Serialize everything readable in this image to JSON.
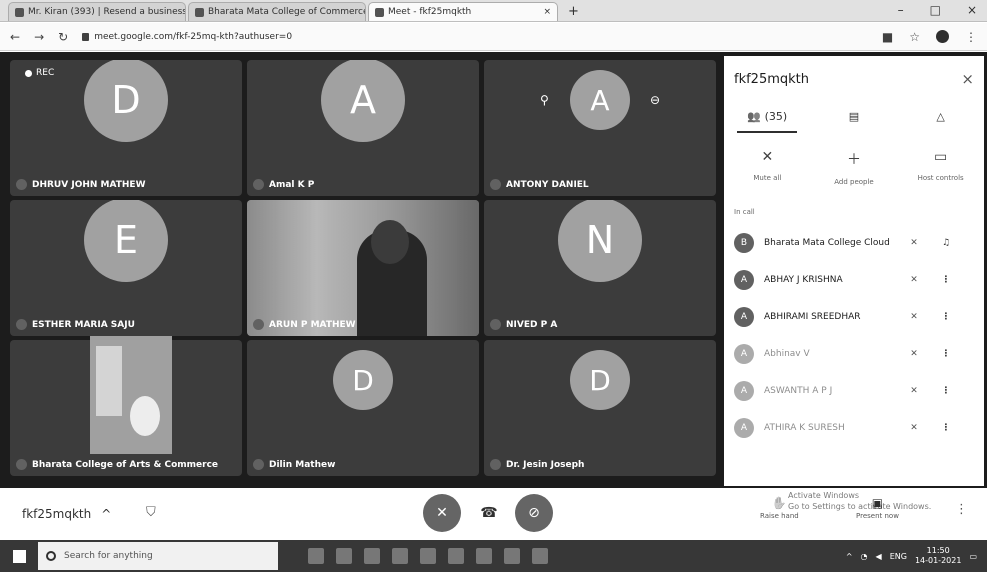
{
  "browser": {
    "tabs": [
      {
        "title": "Mr. Kiran (393) | Resend a business..."
      },
      {
        "title": "Bharata Mata College of Commerce & Mat..."
      },
      {
        "title": "Meet - fkf25mqkth"
      }
    ],
    "new_tab_label": "+",
    "url": "meet.google.com/fkf-25mq-kth?authuser=0",
    "window_controls": {
      "minimize": "–",
      "maximize": "□",
      "close": "×"
    }
  },
  "meeting": {
    "rec_label": "REC",
    "tiles": [
      {
        "initial": "D",
        "name": "DHRUV JOHN MATHEW"
      },
      {
        "initial": "A",
        "name": "Amal K P"
      },
      {
        "initial": "A",
        "name": "ANTONY DANIEL"
      },
      {
        "initial": "E",
        "name": "ESTHER MARIA SAJU"
      },
      {
        "initial": "",
        "name": "ARUN P MATHEW"
      },
      {
        "initial": "N",
        "name": "NIVED P A"
      },
      {
        "initial": "",
        "name": "Bharata College of Arts & Commerce"
      },
      {
        "initial": "D",
        "name": "Dilin Mathew"
      },
      {
        "initial": "D",
        "name": "Dr. Jesin Joseph"
      }
    ]
  },
  "panel": {
    "title": "fkf25mqkth",
    "close_icon": "×",
    "tabs": [
      {
        "label": "(35)",
        "icon": "people-icon"
      },
      {
        "label": "",
        "icon": "chat-icon"
      },
      {
        "label": "",
        "icon": "activities-icon"
      }
    ],
    "actions": [
      {
        "label": "Mute all"
      },
      {
        "label": "Add people"
      },
      {
        "label": "Host controls"
      }
    ],
    "section_label": "In call",
    "participants": [
      {
        "initial": "B",
        "name": "Bharata Mata College Cloud",
        "mic": "✕",
        "more": "♫"
      },
      {
        "initial": "A",
        "name": "ABHAY J KRISHNA",
        "mic": "✕",
        "more": "⋮"
      },
      {
        "initial": "A",
        "name": "ABHIRAMI SREEDHAR",
        "mic": "✕",
        "more": "⋮"
      },
      {
        "initial": "A",
        "name": "Abhinav V",
        "mic": "✕",
        "more": "⋮"
      },
      {
        "initial": "A",
        "name": "ASWANTH A P J",
        "mic": "✕",
        "more": "⋮"
      },
      {
        "initial": "A",
        "name": "ATHIRA K SURESH",
        "mic": "✕",
        "more": "⋮"
      }
    ]
  },
  "controls": {
    "meeting_code": "fkf25mqkth",
    "chevron": "^",
    "raise_hand": "Raise hand",
    "present_now": "Present now",
    "more": "⋮",
    "activate_line1": "Activate Windows",
    "activate_line2": "Go to Settings to activate Windows."
  },
  "taskbar": {
    "search_placeholder": "Search for anything",
    "time": "11:50",
    "date": "14-01-2021",
    "lang": "ENG"
  }
}
